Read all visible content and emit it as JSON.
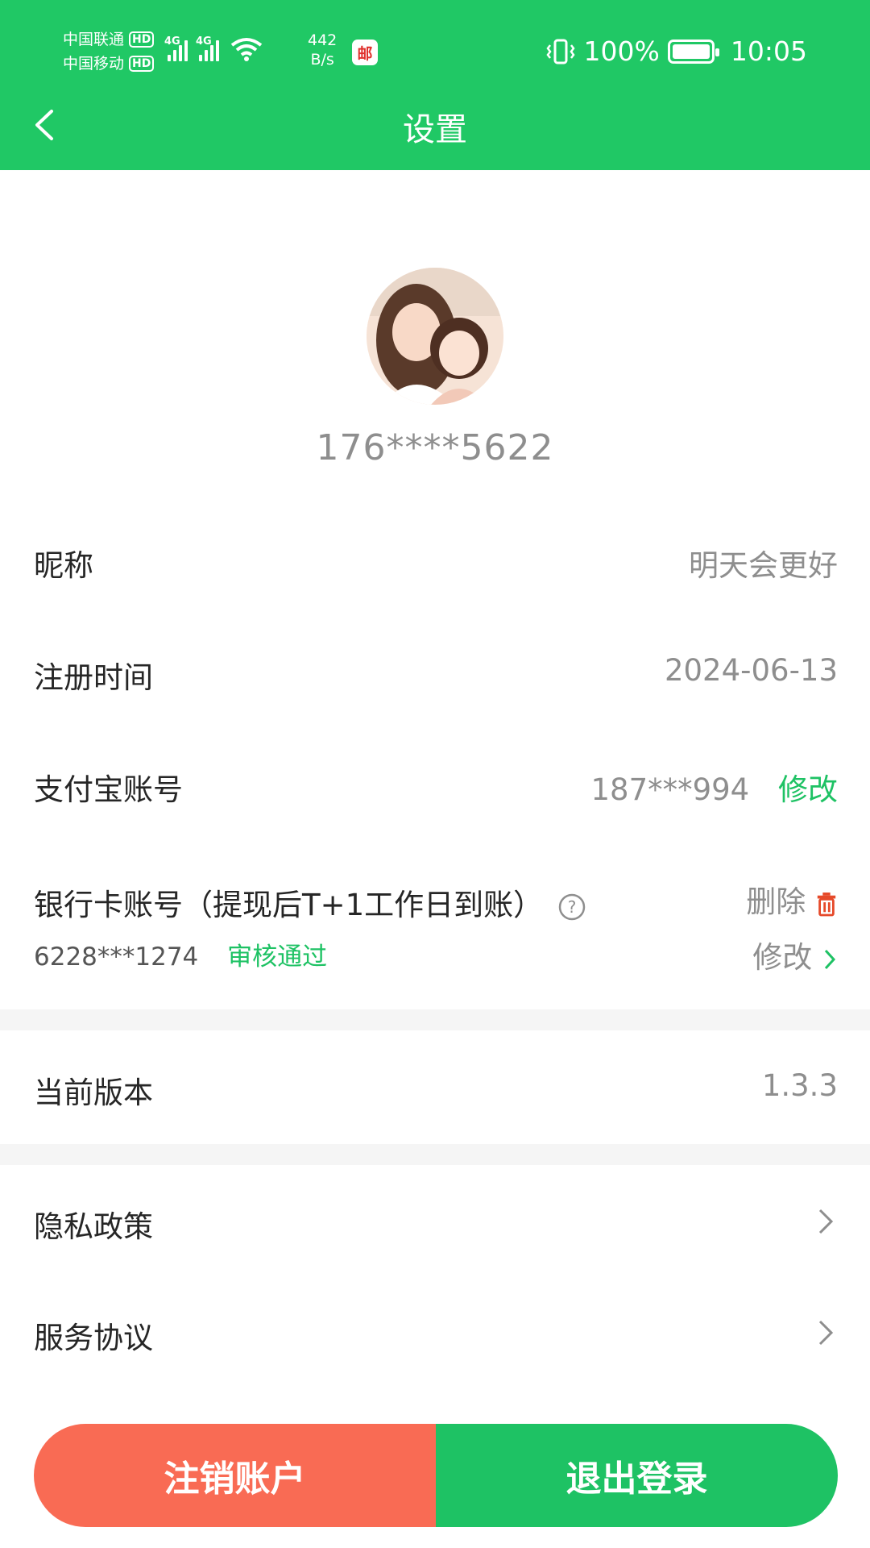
{
  "status_bar": {
    "carrier1": "中国联通",
    "carrier2": "中国移动",
    "hd": "HD",
    "net1": "4G",
    "net2": "4G",
    "speed_value": "442",
    "speed_unit": "B/s",
    "mail_badge": "邮",
    "battery": "100%",
    "time": "10:05"
  },
  "header": {
    "title": "设置"
  },
  "profile": {
    "phone": "176****5622"
  },
  "rows": {
    "nickname": {
      "label": "昵称",
      "value": "明天会更好"
    },
    "register": {
      "label": "注册时间",
      "value": "2024-06-13"
    },
    "alipay": {
      "label": "支付宝账号",
      "value": "187***994",
      "action": "修改"
    },
    "bank": {
      "label": "银行卡账号（提现后T+1工作日到账）",
      "number": "6228***1274",
      "status": "审核通过",
      "delete": "删除",
      "edit": "修改"
    },
    "version": {
      "label": "当前版本",
      "value": "1.3.3"
    },
    "privacy": {
      "label": "隐私政策"
    },
    "service": {
      "label": "服务协议"
    }
  },
  "footer": {
    "cancel_account": "注销账户",
    "logout": "退出登录"
  },
  "colors": {
    "brand_green": "#20c865",
    "danger_red": "#f96b54"
  }
}
